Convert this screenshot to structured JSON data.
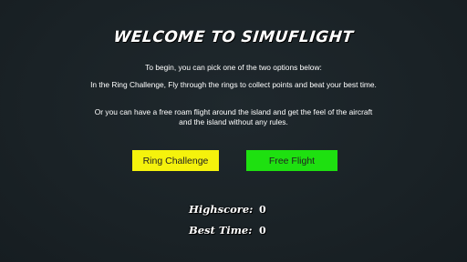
{
  "title": "WELCOME TO SIMUFLIGHT",
  "intro": {
    "line1": "To begin, you can pick one of the two options below:",
    "line2": "In the Ring Challenge, Fly through the rings to collect points and beat your best time.",
    "line3": "Or you can have a free roam flight around the island and get the feel of the aircraft and the island without any rules."
  },
  "buttons": {
    "ring_challenge": "Ring Challenge",
    "free_flight": "Free Flight"
  },
  "stats": {
    "highscore_label": "Highscore:",
    "highscore_value": "0",
    "best_time_label": "Best Time:",
    "best_time_value": "0"
  },
  "colors": {
    "background": "#1b2328",
    "ring_button": "#f5f20c",
    "free_button": "#1ee010"
  }
}
